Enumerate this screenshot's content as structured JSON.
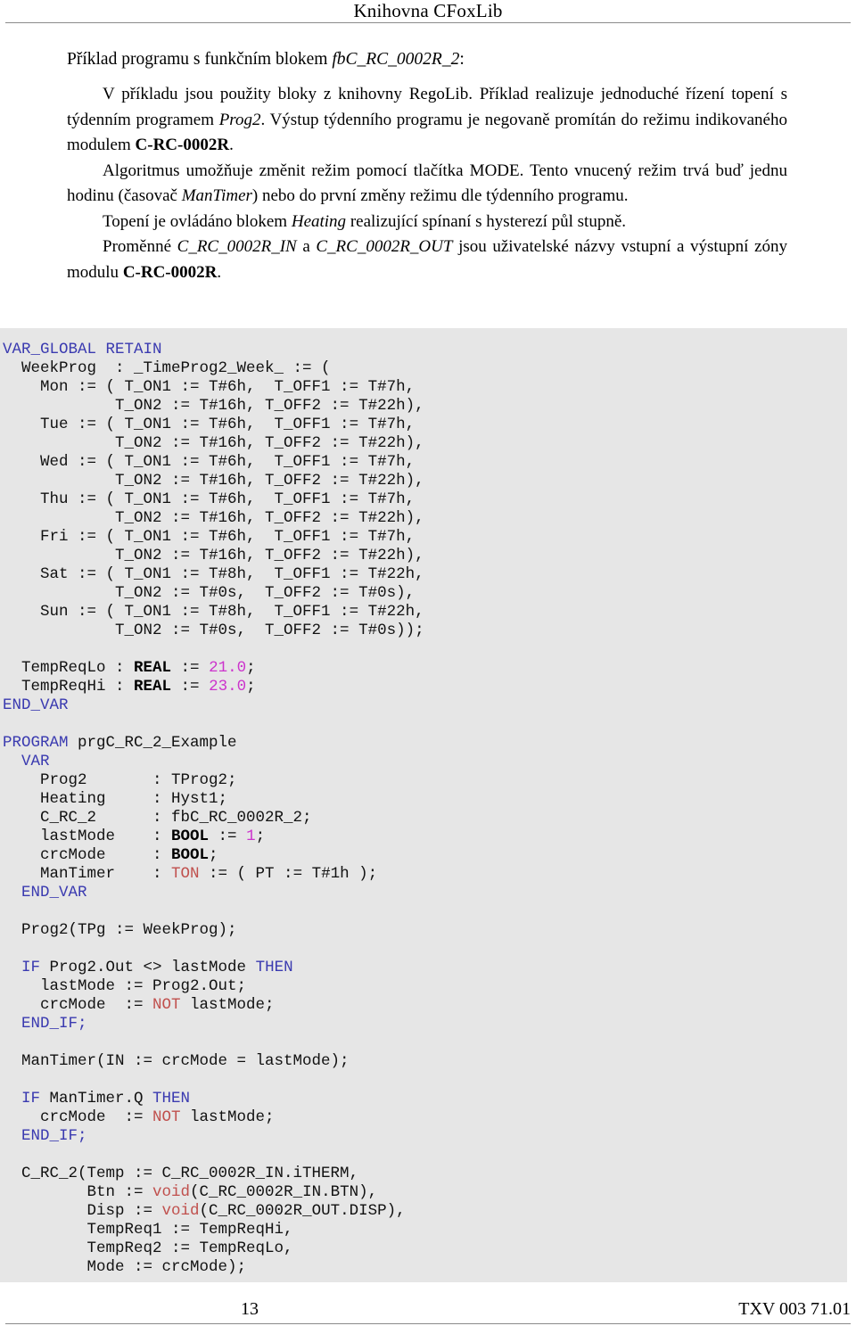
{
  "header": {
    "title": "Knihovna CFoxLib"
  },
  "content": {
    "heading_prefix": "Příklad programu s funkčním blokem ",
    "heading_italic": "fbC_RC_0002R_2",
    "heading_suffix": ":",
    "paragraph1": {
      "t1": "V příkladu jsou použity bloky z knihovny RegoLib. Příklad realizuje jednoduché řízení topení s týdenním programem ",
      "i1": "Prog2",
      "t2": ". Výstup týdenního programu je negovaně promítán do režimu indikovaného modulem ",
      "b1": "C-RC-0002R",
      "t3": "."
    },
    "paragraph2": {
      "t1": "Algoritmus umožňuje změnit režim pomocí tlačítka MODE. Tento vnucený režim trvá buď jednu hodinu (časovač ",
      "i1": "ManTimer",
      "t2": ") nebo do první změny režimu dle týdenního programu."
    },
    "paragraph3": {
      "t1": "Topení je ovládáno blokem ",
      "i1": "Heating",
      "t2": " realizující spínaní s hysterezí půl stupně."
    },
    "paragraph4": {
      "t1": "Proměnné ",
      "i1": "C_RC_0002R_IN",
      "t2": " a ",
      "i2": "C_RC_0002R_OUT",
      "t3": " jsou uživatelské názvy vstupní a výstupní zóny modulu ",
      "b1": "C-RC-0002R",
      "t4": "."
    }
  },
  "code": {
    "language": "Structured Text (IEC 61131-3)",
    "colors": {
      "keyword": "#3a3ab0",
      "type": "#000000",
      "number": "#cc33cc",
      "function": "#c0504d",
      "background": "#e6e6e6"
    },
    "lines": [
      [
        {
          "t": "VAR_GLOBAL RETAIN",
          "c": "kw"
        }
      ],
      [
        {
          "t": "  WeekProg  : _TimeProg2_Week_ := (",
          "c": ""
        }
      ],
      [
        {
          "t": "    Mon := ( T_ON1 := T#6h,  T_OFF1 := T#7h,",
          "c": ""
        }
      ],
      [
        {
          "t": "            T_ON2 := T#16h, T_OFF2 := T#22h),",
          "c": ""
        }
      ],
      [
        {
          "t": "    Tue := ( T_ON1 := T#6h,  T_OFF1 := T#7h,",
          "c": ""
        }
      ],
      [
        {
          "t": "            T_ON2 := T#16h, T_OFF2 := T#22h),",
          "c": ""
        }
      ],
      [
        {
          "t": "    Wed := ( T_ON1 := T#6h,  T_OFF1 := T#7h,",
          "c": ""
        }
      ],
      [
        {
          "t": "            T_ON2 := T#16h, T_OFF2 := T#22h),",
          "c": ""
        }
      ],
      [
        {
          "t": "    Thu := ( T_ON1 := T#6h,  T_OFF1 := T#7h,",
          "c": ""
        }
      ],
      [
        {
          "t": "            T_ON2 := T#16h, T_OFF2 := T#22h),",
          "c": ""
        }
      ],
      [
        {
          "t": "    Fri := ( T_ON1 := T#6h,  T_OFF1 := T#7h,",
          "c": ""
        }
      ],
      [
        {
          "t": "            T_ON2 := T#16h, T_OFF2 := T#22h),",
          "c": ""
        }
      ],
      [
        {
          "t": "    Sat := ( T_ON1 := T#8h,  T_OFF1 := T#22h,",
          "c": ""
        }
      ],
      [
        {
          "t": "            T_ON2 := T#0s,  T_OFF2 := T#0s),",
          "c": ""
        }
      ],
      [
        {
          "t": "    Sun := ( T_ON1 := T#8h,  T_OFF1 := T#22h,",
          "c": ""
        }
      ],
      [
        {
          "t": "            T_ON2 := T#0s,  T_OFF2 := T#0s));",
          "c": ""
        }
      ],
      [
        {
          "t": "",
          "c": ""
        }
      ],
      [
        {
          "t": "  TempReqLo : ",
          "c": ""
        },
        {
          "t": "REAL",
          "c": "type"
        },
        {
          "t": " := ",
          "c": ""
        },
        {
          "t": "21.0",
          "c": "num"
        },
        {
          "t": ";",
          "c": ""
        }
      ],
      [
        {
          "t": "  TempReqHi : ",
          "c": ""
        },
        {
          "t": "REAL",
          "c": "type"
        },
        {
          "t": " := ",
          "c": ""
        },
        {
          "t": "23.0",
          "c": "num"
        },
        {
          "t": ";",
          "c": ""
        }
      ],
      [
        {
          "t": "END_VAR",
          "c": "kw"
        }
      ],
      [
        {
          "t": "",
          "c": ""
        }
      ],
      [
        {
          "t": "PROGRAM",
          "c": "kw"
        },
        {
          "t": " prgC_RC_2_Example",
          "c": ""
        }
      ],
      [
        {
          "t": "  VAR",
          "c": "kw"
        }
      ],
      [
        {
          "t": "    Prog2       : TProg2;",
          "c": ""
        }
      ],
      [
        {
          "t": "    Heating     : Hyst1;",
          "c": ""
        }
      ],
      [
        {
          "t": "    C_RC_2      : fbC_RC_0002R_2;",
          "c": ""
        }
      ],
      [
        {
          "t": "    lastMode    : ",
          "c": ""
        },
        {
          "t": "BOOL",
          "c": "type"
        },
        {
          "t": " := ",
          "c": ""
        },
        {
          "t": "1",
          "c": "num"
        },
        {
          "t": ";",
          "c": ""
        }
      ],
      [
        {
          "t": "    crcMode     : ",
          "c": ""
        },
        {
          "t": "BOOL",
          "c": "type"
        },
        {
          "t": ";",
          "c": ""
        }
      ],
      [
        {
          "t": "    ManTimer    : ",
          "c": ""
        },
        {
          "t": "TON",
          "c": "fn"
        },
        {
          "t": " := ( PT := T#1h );",
          "c": ""
        }
      ],
      [
        {
          "t": "  END_VAR",
          "c": "kw"
        }
      ],
      [
        {
          "t": "",
          "c": ""
        }
      ],
      [
        {
          "t": "  Prog2(TPg := WeekProg);",
          "c": ""
        }
      ],
      [
        {
          "t": "",
          "c": ""
        }
      ],
      [
        {
          "t": "  IF",
          "c": "kw"
        },
        {
          "t": " Prog2.Out <> lastMode ",
          "c": ""
        },
        {
          "t": "THEN",
          "c": "kw"
        }
      ],
      [
        {
          "t": "    lastMode := Prog2.Out;",
          "c": ""
        }
      ],
      [
        {
          "t": "    crcMode  := ",
          "c": ""
        },
        {
          "t": "NOT",
          "c": "fn"
        },
        {
          "t": " lastMode;",
          "c": ""
        }
      ],
      [
        {
          "t": "  END_IF;",
          "c": "kw"
        }
      ],
      [
        {
          "t": "",
          "c": ""
        }
      ],
      [
        {
          "t": "  ManTimer(IN := crcMode = lastMode);",
          "c": ""
        }
      ],
      [
        {
          "t": "",
          "c": ""
        }
      ],
      [
        {
          "t": "  IF",
          "c": "kw"
        },
        {
          "t": " ManTimer.Q ",
          "c": ""
        },
        {
          "t": "THEN",
          "c": "kw"
        }
      ],
      [
        {
          "t": "    crcMode  := ",
          "c": ""
        },
        {
          "t": "NOT",
          "c": "fn"
        },
        {
          "t": " lastMode;",
          "c": ""
        }
      ],
      [
        {
          "t": "  END_IF;",
          "c": "kw"
        }
      ],
      [
        {
          "t": "",
          "c": ""
        }
      ],
      [
        {
          "t": "  C_RC_2(Temp := C_RC_0002R_IN.iTHERM,",
          "c": ""
        }
      ],
      [
        {
          "t": "         Btn := ",
          "c": ""
        },
        {
          "t": "void",
          "c": "fn"
        },
        {
          "t": "(C_RC_0002R_IN.BTN),",
          "c": ""
        }
      ],
      [
        {
          "t": "         Disp := ",
          "c": ""
        },
        {
          "t": "void",
          "c": "fn"
        },
        {
          "t": "(C_RC_0002R_OUT.DISP),",
          "c": ""
        }
      ],
      [
        {
          "t": "         TempReq1 := TempReqHi,",
          "c": ""
        }
      ],
      [
        {
          "t": "         TempReq2 := TempReqLo,",
          "c": ""
        }
      ],
      [
        {
          "t": "         Mode := crcMode);",
          "c": ""
        }
      ]
    ]
  },
  "footer": {
    "page_number": "13",
    "doc_id": "TXV 003 71.01"
  }
}
